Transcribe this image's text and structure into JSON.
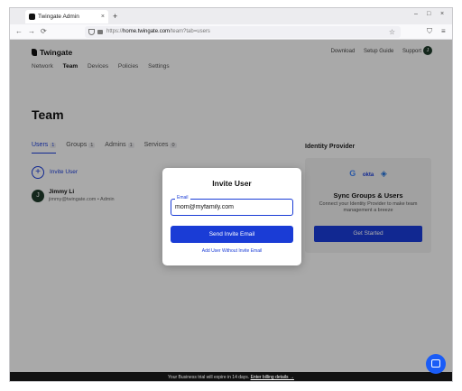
{
  "browser": {
    "tab_title": "Twingate Admin",
    "tab_close": "×",
    "new_tab": "+",
    "url_prefix": "https://",
    "url_host": "home.twingate.com",
    "url_path": "/team?tab=users",
    "back": "←",
    "forward": "→",
    "reload": "⟳",
    "bookmark": "☆",
    "minimize": "–",
    "maximize": "□",
    "close": "×",
    "menu": "≡",
    "pocket": "⛉"
  },
  "header": {
    "logo_text": "Twingate",
    "links": [
      "Download",
      "Setup Guide",
      "Support"
    ],
    "avatar_initial": "J"
  },
  "nav": {
    "items": [
      {
        "label": "Network",
        "active": false
      },
      {
        "label": "Team",
        "active": true
      },
      {
        "label": "Devices",
        "active": false
      },
      {
        "label": "Policies",
        "active": false
      },
      {
        "label": "Settings",
        "active": false
      }
    ]
  },
  "main": {
    "title": "Team",
    "tabs": [
      {
        "label": "Users",
        "count": "1"
      },
      {
        "label": "Groups",
        "count": "1"
      },
      {
        "label": "Admins",
        "count": "1"
      },
      {
        "label": "Services",
        "count": "0"
      }
    ],
    "invite_label": "Invite User",
    "users": [
      {
        "initial": "J",
        "name": "Jimmy Li",
        "meta": "jimmy@twingate.com • Admin"
      }
    ]
  },
  "identity_provider": {
    "title": "Identity Provider",
    "logos": [
      "G",
      "okta",
      "◈"
    ],
    "heading": "Sync Groups & Users",
    "description": "Connect your Identity Provider to make team management a breeze",
    "button": "Get Started"
  },
  "modal": {
    "title": "Invite User",
    "email_label": "Email",
    "email_value": "mom@myfamily.com",
    "send_button": "Send Invite Email",
    "alt_link": "Add User Without Invite Email"
  },
  "banner": {
    "text": "Your Business trial will expire in 14 days.",
    "link": "Enter billing details →"
  },
  "colors": {
    "accent": "#1a3cd6",
    "chat": "#1a5cf6"
  }
}
